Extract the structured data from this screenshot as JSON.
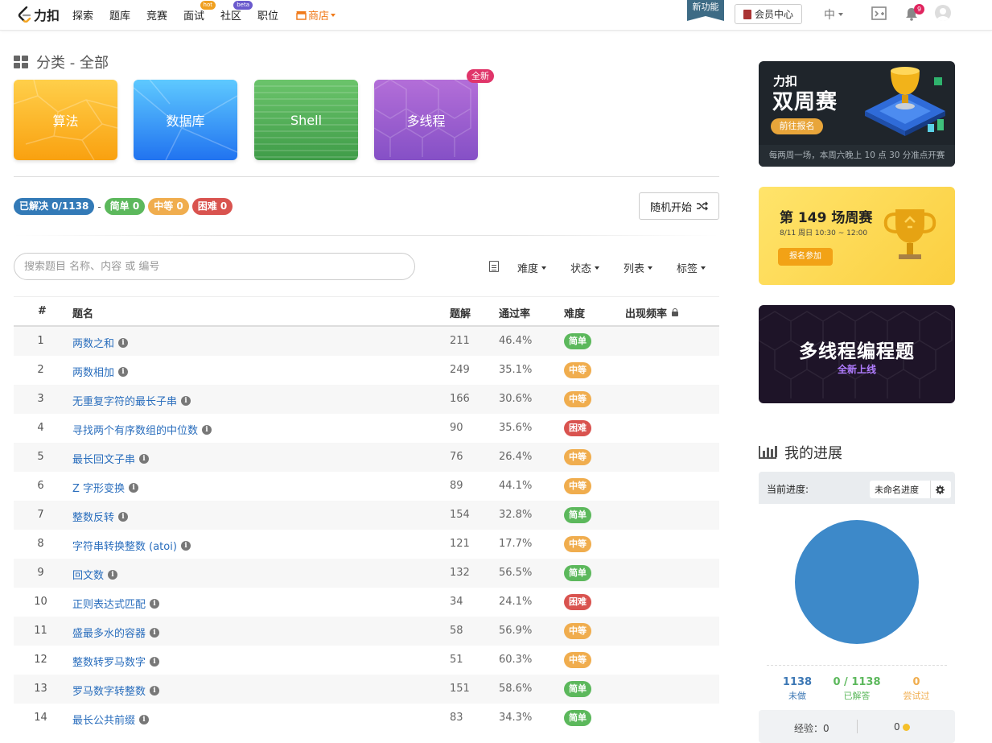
{
  "nav": {
    "logo_text": "力扣",
    "items": [
      "探索",
      "题库",
      "竞赛",
      "面试",
      "社区",
      "职位"
    ],
    "badges": {
      "interview": "hot",
      "community": "beta"
    },
    "store": "商店",
    "new_feature": "新功能",
    "vip": "会员中心",
    "lang": "中",
    "notifications": "9"
  },
  "category": {
    "title": "分类 - 全部",
    "cards": [
      "算法",
      "数据库",
      "Shell",
      "多线程"
    ],
    "new_tag": "全新"
  },
  "stats": {
    "solved": "已解决 0/1138",
    "sep": "-",
    "easy": "简单 0",
    "medium": "中等 0",
    "hard": "困难 0"
  },
  "random_button": "随机开始",
  "search": {
    "placeholder": "搜索题目 名称、内容 或 编号"
  },
  "filters": [
    "难度",
    "状态",
    "列表",
    "标签"
  ],
  "table": {
    "headers": {
      "idx": "#",
      "title": "题名",
      "solutions": "题解",
      "rate": "通过率",
      "difficulty": "难度",
      "frequency": "出现频率"
    },
    "rows": [
      {
        "idx": "1",
        "title": "两数之和",
        "solutions": "211",
        "rate": "46.4%",
        "difficulty": "简单",
        "level": "easy"
      },
      {
        "idx": "2",
        "title": "两数相加",
        "solutions": "249",
        "rate": "35.1%",
        "difficulty": "中等",
        "level": "medium"
      },
      {
        "idx": "3",
        "title": "无重复字符的最长子串",
        "solutions": "166",
        "rate": "30.6%",
        "difficulty": "中等",
        "level": "medium"
      },
      {
        "idx": "4",
        "title": "寻找两个有序数组的中位数",
        "solutions": "90",
        "rate": "35.6%",
        "difficulty": "困难",
        "level": "hard"
      },
      {
        "idx": "5",
        "title": "最长回文子串",
        "solutions": "76",
        "rate": "26.4%",
        "difficulty": "中等",
        "level": "medium"
      },
      {
        "idx": "6",
        "title": "Z 字形变换",
        "solutions": "89",
        "rate": "44.1%",
        "difficulty": "中等",
        "level": "medium"
      },
      {
        "idx": "7",
        "title": "整数反转",
        "solutions": "154",
        "rate": "32.8%",
        "difficulty": "简单",
        "level": "easy"
      },
      {
        "idx": "8",
        "title": "字符串转换整数 (atoi)",
        "solutions": "121",
        "rate": "17.7%",
        "difficulty": "中等",
        "level": "medium"
      },
      {
        "idx": "9",
        "title": "回文数",
        "solutions": "132",
        "rate": "56.5%",
        "difficulty": "简单",
        "level": "easy"
      },
      {
        "idx": "10",
        "title": "正则表达式匹配",
        "solutions": "34",
        "rate": "24.1%",
        "difficulty": "困难",
        "level": "hard"
      },
      {
        "idx": "11",
        "title": "盛最多水的容器",
        "solutions": "58",
        "rate": "56.9%",
        "difficulty": "中等",
        "level": "medium"
      },
      {
        "idx": "12",
        "title": "整数转罗马数字",
        "solutions": "51",
        "rate": "60.3%",
        "difficulty": "中等",
        "level": "medium"
      },
      {
        "idx": "13",
        "title": "罗马数字转整数",
        "solutions": "151",
        "rate": "58.6%",
        "difficulty": "简单",
        "level": "easy"
      },
      {
        "idx": "14",
        "title": "最长公共前缀",
        "solutions": "83",
        "rate": "34.3%",
        "difficulty": "简单",
        "level": "easy"
      }
    ]
  },
  "sidebar": {
    "biweekly": {
      "line1": "力扣",
      "line2": "双周赛",
      "button": "前往报名",
      "footer": "每两周一场，本周六晚上 10 点 30 分准点开赛"
    },
    "weekly": {
      "title": "第 149 场周赛",
      "time": "8/11 周日 10:30 ~ 12:00",
      "button": "报名参加"
    },
    "multithread": {
      "title": "多线程编程题",
      "subtitle": "全新上线"
    },
    "progress": {
      "title": "我的进展",
      "current_label": "当前进度:",
      "select_value": "未命名进度",
      "todo": {
        "num": "1138",
        "cap": "未做"
      },
      "solved": {
        "num": "0 / 1138",
        "cap": "已解答"
      },
      "attempted": {
        "num": "0",
        "cap": "尝试过"
      },
      "exp_label": "经验：0",
      "coins": "0"
    }
  },
  "colors": {
    "link": "#2a6ebd",
    "easy": "#5cb85c",
    "medium": "#f0ad4e",
    "hard": "#d9534f",
    "pie": "#3d89c9"
  }
}
